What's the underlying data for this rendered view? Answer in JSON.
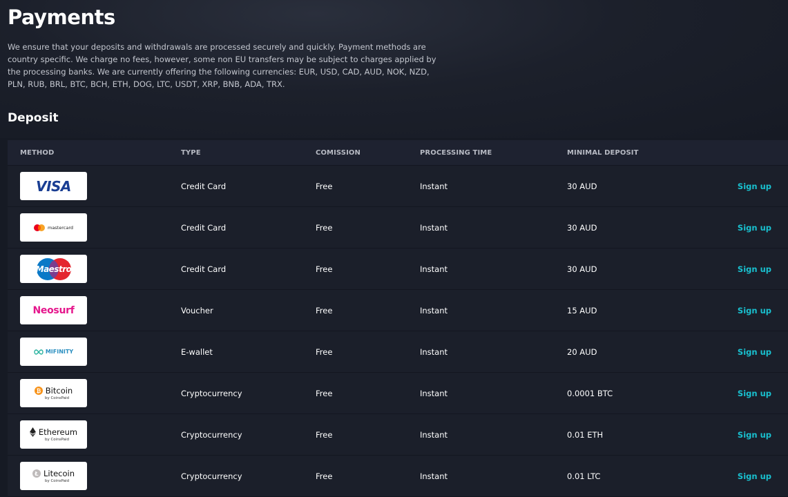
{
  "page": {
    "title": "Payments",
    "intro": "We ensure that your deposits and withdrawals are processed securely and quickly. Payment methods are country specific. We charge no fees, however, some non EU transfers may be subject to charges applied by the processing banks. We are currently offering the following currencies: EUR, USD, CAD, AUD, NOK, NZD, PLN, RUB, BRL, BTC, BCH, ETH, DOG, LTC, USDT, XRP, BNB, ADA, TRX.",
    "section_title": "Deposit"
  },
  "table": {
    "headers": {
      "method": "METHOD",
      "type": "TYPE",
      "commission": "COMISSION",
      "processing_time": "PROCESSING TIME",
      "minimal_deposit": "MINIMAL DEPOSIT"
    },
    "rows": [
      {
        "logo_text": "VISA",
        "logo_icon": "visa-logo",
        "type": "Credit Card",
        "commission": "Free",
        "processing_time": "Instant",
        "minimal_deposit": "30 AUD",
        "action": "Sign up"
      },
      {
        "logo_text": "mastercard",
        "logo_icon": "mastercard-logo",
        "type": "Credit Card",
        "commission": "Free",
        "processing_time": "Instant",
        "minimal_deposit": "30 AUD",
        "action": "Sign up"
      },
      {
        "logo_text": "Maestro",
        "logo_icon": "maestro-logo",
        "type": "Credit Card",
        "commission": "Free",
        "processing_time": "Instant",
        "minimal_deposit": "30 AUD",
        "action": "Sign up"
      },
      {
        "logo_text": "Neosurf",
        "logo_icon": "neosurf-logo",
        "type": "Voucher",
        "commission": "Free",
        "processing_time": "Instant",
        "minimal_deposit": "15 AUD",
        "action": "Sign up"
      },
      {
        "logo_text": "MIFINITY",
        "logo_icon": "mifinity-logo",
        "type": "E-wallet",
        "commission": "Free",
        "processing_time": "Instant",
        "minimal_deposit": "20 AUD",
        "action": "Sign up"
      },
      {
        "logo_text": "Bitcoin",
        "logo_sub": "by CoinsPaid",
        "logo_icon": "bitcoin-icon",
        "type": "Cryptocurrency",
        "commission": "Free",
        "processing_time": "Instant",
        "minimal_deposit": "0.0001 BTC",
        "action": "Sign up"
      },
      {
        "logo_text": "Ethereum",
        "logo_sub": "by CoinsPaid",
        "logo_icon": "ethereum-icon",
        "type": "Cryptocurrency",
        "commission": "Free",
        "processing_time": "Instant",
        "minimal_deposit": "0.01 ETH",
        "action": "Sign up"
      },
      {
        "logo_text": "Litecoin",
        "logo_sub": "by CoinsPaid",
        "logo_icon": "litecoin-icon",
        "type": "Cryptocurrency",
        "commission": "Free",
        "processing_time": "Instant",
        "minimal_deposit": "0.01 LTC",
        "action": "Sign up"
      }
    ]
  },
  "colors": {
    "background": "#161a24",
    "table_row": "#1b1f2a",
    "accent": "#19c0cf"
  }
}
